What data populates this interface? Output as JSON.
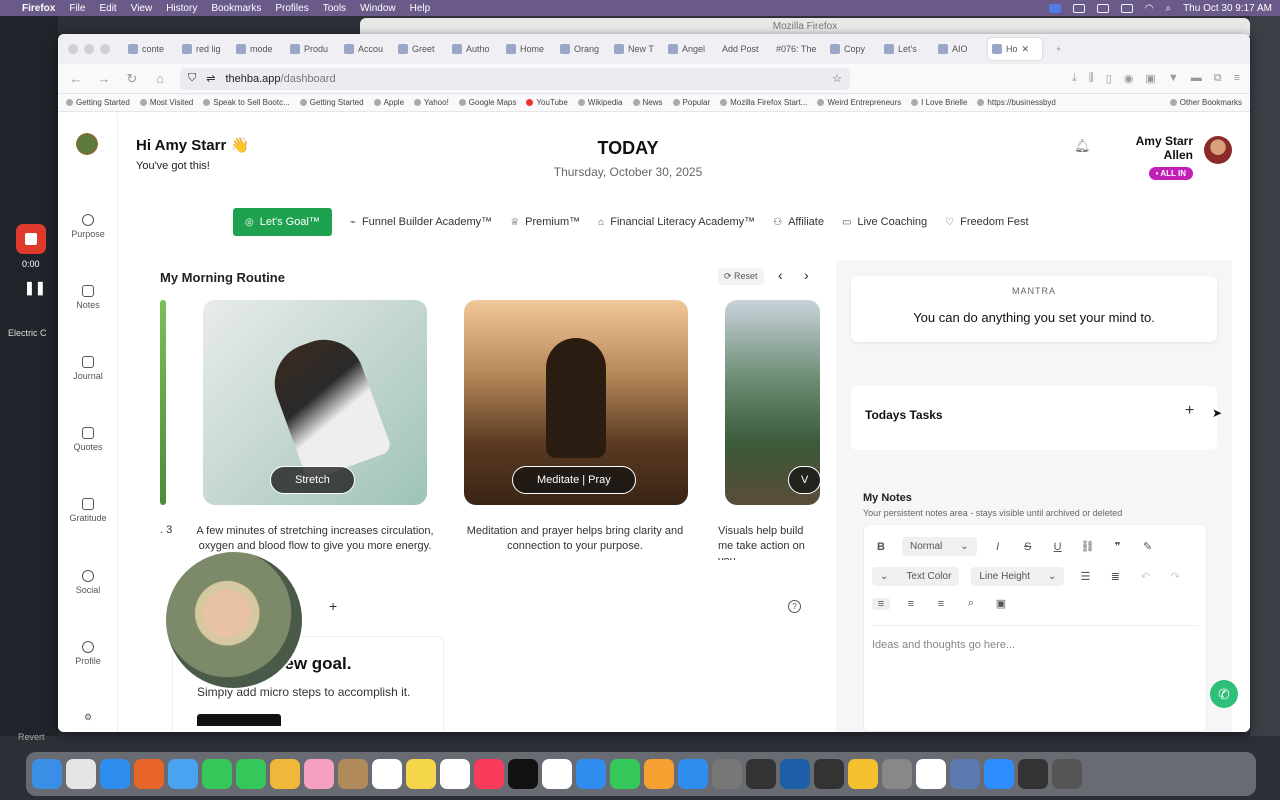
{
  "menubar": {
    "app": "Firefox",
    "items": [
      "File",
      "Edit",
      "View",
      "History",
      "Bookmarks",
      "Profiles",
      "Tools",
      "Window",
      "Help"
    ],
    "clock": "Thu Oct 30  9:17 AM"
  },
  "desktop": {
    "recorder_time": "0:00",
    "left_label": "Electric C",
    "revert": "Revert"
  },
  "bg_window_title": "Mozilla Firefox",
  "tabs": [
    {
      "label": "conte"
    },
    {
      "label": "red lig"
    },
    {
      "label": "mode"
    },
    {
      "label": "Produ"
    },
    {
      "label": "Accou"
    },
    {
      "label": "Greet"
    },
    {
      "label": "Autho"
    },
    {
      "label": "Home"
    },
    {
      "label": "Orang"
    },
    {
      "label": "New T"
    },
    {
      "label": "Angel"
    },
    {
      "label": "Add Post"
    },
    {
      "label": "#076: The"
    },
    {
      "label": "Copy"
    },
    {
      "label": "Let's"
    },
    {
      "label": "AIO"
    },
    {
      "label": "Ho"
    }
  ],
  "url": {
    "host": "thehba.app",
    "path": "/dashboard"
  },
  "bookmarks": [
    "Getting Started",
    "Most Visited",
    "Speak to Sell Bootc...",
    "Getting Started",
    "Apple",
    "Yahoo!",
    "Google Maps",
    "YouTube",
    "Wikipedia",
    "News",
    "Popular",
    "Mozilla Firefox Start...",
    "Weird Entrepreneurs",
    "I Love Brielle",
    "https://businessbyd"
  ],
  "other_bookmarks": "Other Bookmarks",
  "sidebar": {
    "items": [
      {
        "label": "Purpose",
        "icon": "target-icon"
      },
      {
        "label": "Notes",
        "icon": "notes-icon"
      },
      {
        "label": "Journal",
        "icon": "book-icon"
      },
      {
        "label": "Quotes",
        "icon": "quote-icon"
      },
      {
        "label": "Gratitude",
        "icon": "thumbs-up-icon"
      },
      {
        "label": "Social",
        "icon": "people-icon"
      },
      {
        "label": "Profile",
        "icon": "profile-icon"
      }
    ]
  },
  "header": {
    "greeting": "Hi Amy Starr 👋",
    "subgreeting": "You've got this!",
    "today": "TODAY",
    "date": "Thursday, October 30, 2025",
    "user_name": "Amy Starr Allen",
    "badge": "• ALL IN"
  },
  "topnav": [
    {
      "label": "Let's Goal™",
      "icon": "◎"
    },
    {
      "label": "Funnel Builder Academy™",
      "icon": "⌁"
    },
    {
      "label": "Premium™",
      "icon": "♕"
    },
    {
      "label": "Financial Literacy Academy™",
      "icon": "⌂"
    },
    {
      "label": "Affiliate",
      "icon": "⚇"
    },
    {
      "label": "Live Coaching",
      "icon": "▭"
    },
    {
      "label": "Freedom Fest",
      "icon": "♡"
    }
  ],
  "routine": {
    "title": "My Morning Routine",
    "reset": "⟳ Reset",
    "peek_num": ". 3",
    "cards": [
      {
        "label": "Stretch",
        "desc": "A few minutes of stretching increases circulation, oxygen and blood flow to give you more energy."
      },
      {
        "label": "Meditate | Pray",
        "desc": "Meditation and prayer helps bring clarity and connection to your purpose."
      },
      {
        "label": "V",
        "desc": "Visuals help build me take action on you"
      }
    ]
  },
  "goal": {
    "title": "new goal.",
    "sub": "Simply add micro steps to accomplish it."
  },
  "mantra": {
    "label": "MANTRA",
    "text": "You can do anything you set your mind to."
  },
  "tasks": {
    "title": "Todays Tasks"
  },
  "notes": {
    "title": "My Notes",
    "sub": "Your persistent notes area - stays visible until archived or deleted",
    "format": "Normal",
    "text_color": "Text Color",
    "line_height": "Line Height",
    "placeholder": "Ideas and thoughts go here..."
  }
}
